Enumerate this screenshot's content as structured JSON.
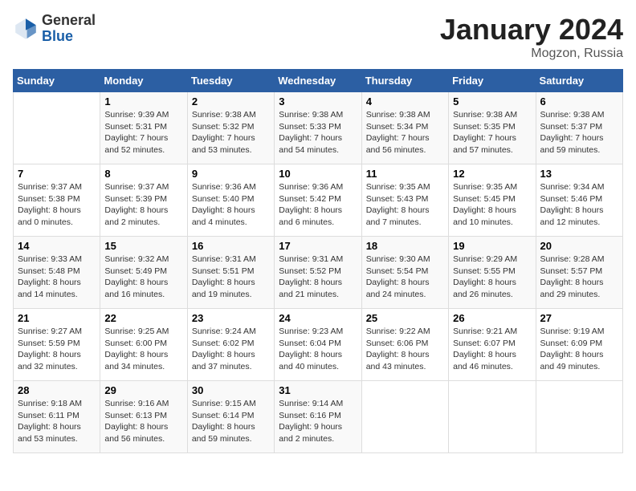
{
  "header": {
    "logo_general": "General",
    "logo_blue": "Blue",
    "month_title": "January 2024",
    "location": "Mogzon, Russia"
  },
  "weekdays": [
    "Sunday",
    "Monday",
    "Tuesday",
    "Wednesday",
    "Thursday",
    "Friday",
    "Saturday"
  ],
  "weeks": [
    [
      {
        "day": "",
        "info": ""
      },
      {
        "day": "1",
        "info": "Sunrise: 9:39 AM\nSunset: 5:31 PM\nDaylight: 7 hours\nand 52 minutes."
      },
      {
        "day": "2",
        "info": "Sunrise: 9:38 AM\nSunset: 5:32 PM\nDaylight: 7 hours\nand 53 minutes."
      },
      {
        "day": "3",
        "info": "Sunrise: 9:38 AM\nSunset: 5:33 PM\nDaylight: 7 hours\nand 54 minutes."
      },
      {
        "day": "4",
        "info": "Sunrise: 9:38 AM\nSunset: 5:34 PM\nDaylight: 7 hours\nand 56 minutes."
      },
      {
        "day": "5",
        "info": "Sunrise: 9:38 AM\nSunset: 5:35 PM\nDaylight: 7 hours\nand 57 minutes."
      },
      {
        "day": "6",
        "info": "Sunrise: 9:38 AM\nSunset: 5:37 PM\nDaylight: 7 hours\nand 59 minutes."
      }
    ],
    [
      {
        "day": "7",
        "info": "Sunrise: 9:37 AM\nSunset: 5:38 PM\nDaylight: 8 hours\nand 0 minutes."
      },
      {
        "day": "8",
        "info": "Sunrise: 9:37 AM\nSunset: 5:39 PM\nDaylight: 8 hours\nand 2 minutes."
      },
      {
        "day": "9",
        "info": "Sunrise: 9:36 AM\nSunset: 5:40 PM\nDaylight: 8 hours\nand 4 minutes."
      },
      {
        "day": "10",
        "info": "Sunrise: 9:36 AM\nSunset: 5:42 PM\nDaylight: 8 hours\nand 6 minutes."
      },
      {
        "day": "11",
        "info": "Sunrise: 9:35 AM\nSunset: 5:43 PM\nDaylight: 8 hours\nand 7 minutes."
      },
      {
        "day": "12",
        "info": "Sunrise: 9:35 AM\nSunset: 5:45 PM\nDaylight: 8 hours\nand 10 minutes."
      },
      {
        "day": "13",
        "info": "Sunrise: 9:34 AM\nSunset: 5:46 PM\nDaylight: 8 hours\nand 12 minutes."
      }
    ],
    [
      {
        "day": "14",
        "info": "Sunrise: 9:33 AM\nSunset: 5:48 PM\nDaylight: 8 hours\nand 14 minutes."
      },
      {
        "day": "15",
        "info": "Sunrise: 9:32 AM\nSunset: 5:49 PM\nDaylight: 8 hours\nand 16 minutes."
      },
      {
        "day": "16",
        "info": "Sunrise: 9:31 AM\nSunset: 5:51 PM\nDaylight: 8 hours\nand 19 minutes."
      },
      {
        "day": "17",
        "info": "Sunrise: 9:31 AM\nSunset: 5:52 PM\nDaylight: 8 hours\nand 21 minutes."
      },
      {
        "day": "18",
        "info": "Sunrise: 9:30 AM\nSunset: 5:54 PM\nDaylight: 8 hours\nand 24 minutes."
      },
      {
        "day": "19",
        "info": "Sunrise: 9:29 AM\nSunset: 5:55 PM\nDaylight: 8 hours\nand 26 minutes."
      },
      {
        "day": "20",
        "info": "Sunrise: 9:28 AM\nSunset: 5:57 PM\nDaylight: 8 hours\nand 29 minutes."
      }
    ],
    [
      {
        "day": "21",
        "info": "Sunrise: 9:27 AM\nSunset: 5:59 PM\nDaylight: 8 hours\nand 32 minutes."
      },
      {
        "day": "22",
        "info": "Sunrise: 9:25 AM\nSunset: 6:00 PM\nDaylight: 8 hours\nand 34 minutes."
      },
      {
        "day": "23",
        "info": "Sunrise: 9:24 AM\nSunset: 6:02 PM\nDaylight: 8 hours\nand 37 minutes."
      },
      {
        "day": "24",
        "info": "Sunrise: 9:23 AM\nSunset: 6:04 PM\nDaylight: 8 hours\nand 40 minutes."
      },
      {
        "day": "25",
        "info": "Sunrise: 9:22 AM\nSunset: 6:06 PM\nDaylight: 8 hours\nand 43 minutes."
      },
      {
        "day": "26",
        "info": "Sunrise: 9:21 AM\nSunset: 6:07 PM\nDaylight: 8 hours\nand 46 minutes."
      },
      {
        "day": "27",
        "info": "Sunrise: 9:19 AM\nSunset: 6:09 PM\nDaylight: 8 hours\nand 49 minutes."
      }
    ],
    [
      {
        "day": "28",
        "info": "Sunrise: 9:18 AM\nSunset: 6:11 PM\nDaylight: 8 hours\nand 53 minutes."
      },
      {
        "day": "29",
        "info": "Sunrise: 9:16 AM\nSunset: 6:13 PM\nDaylight: 8 hours\nand 56 minutes."
      },
      {
        "day": "30",
        "info": "Sunrise: 9:15 AM\nSunset: 6:14 PM\nDaylight: 8 hours\nand 59 minutes."
      },
      {
        "day": "31",
        "info": "Sunrise: 9:14 AM\nSunset: 6:16 PM\nDaylight: 9 hours\nand 2 minutes."
      },
      {
        "day": "",
        "info": ""
      },
      {
        "day": "",
        "info": ""
      },
      {
        "day": "",
        "info": ""
      }
    ]
  ]
}
